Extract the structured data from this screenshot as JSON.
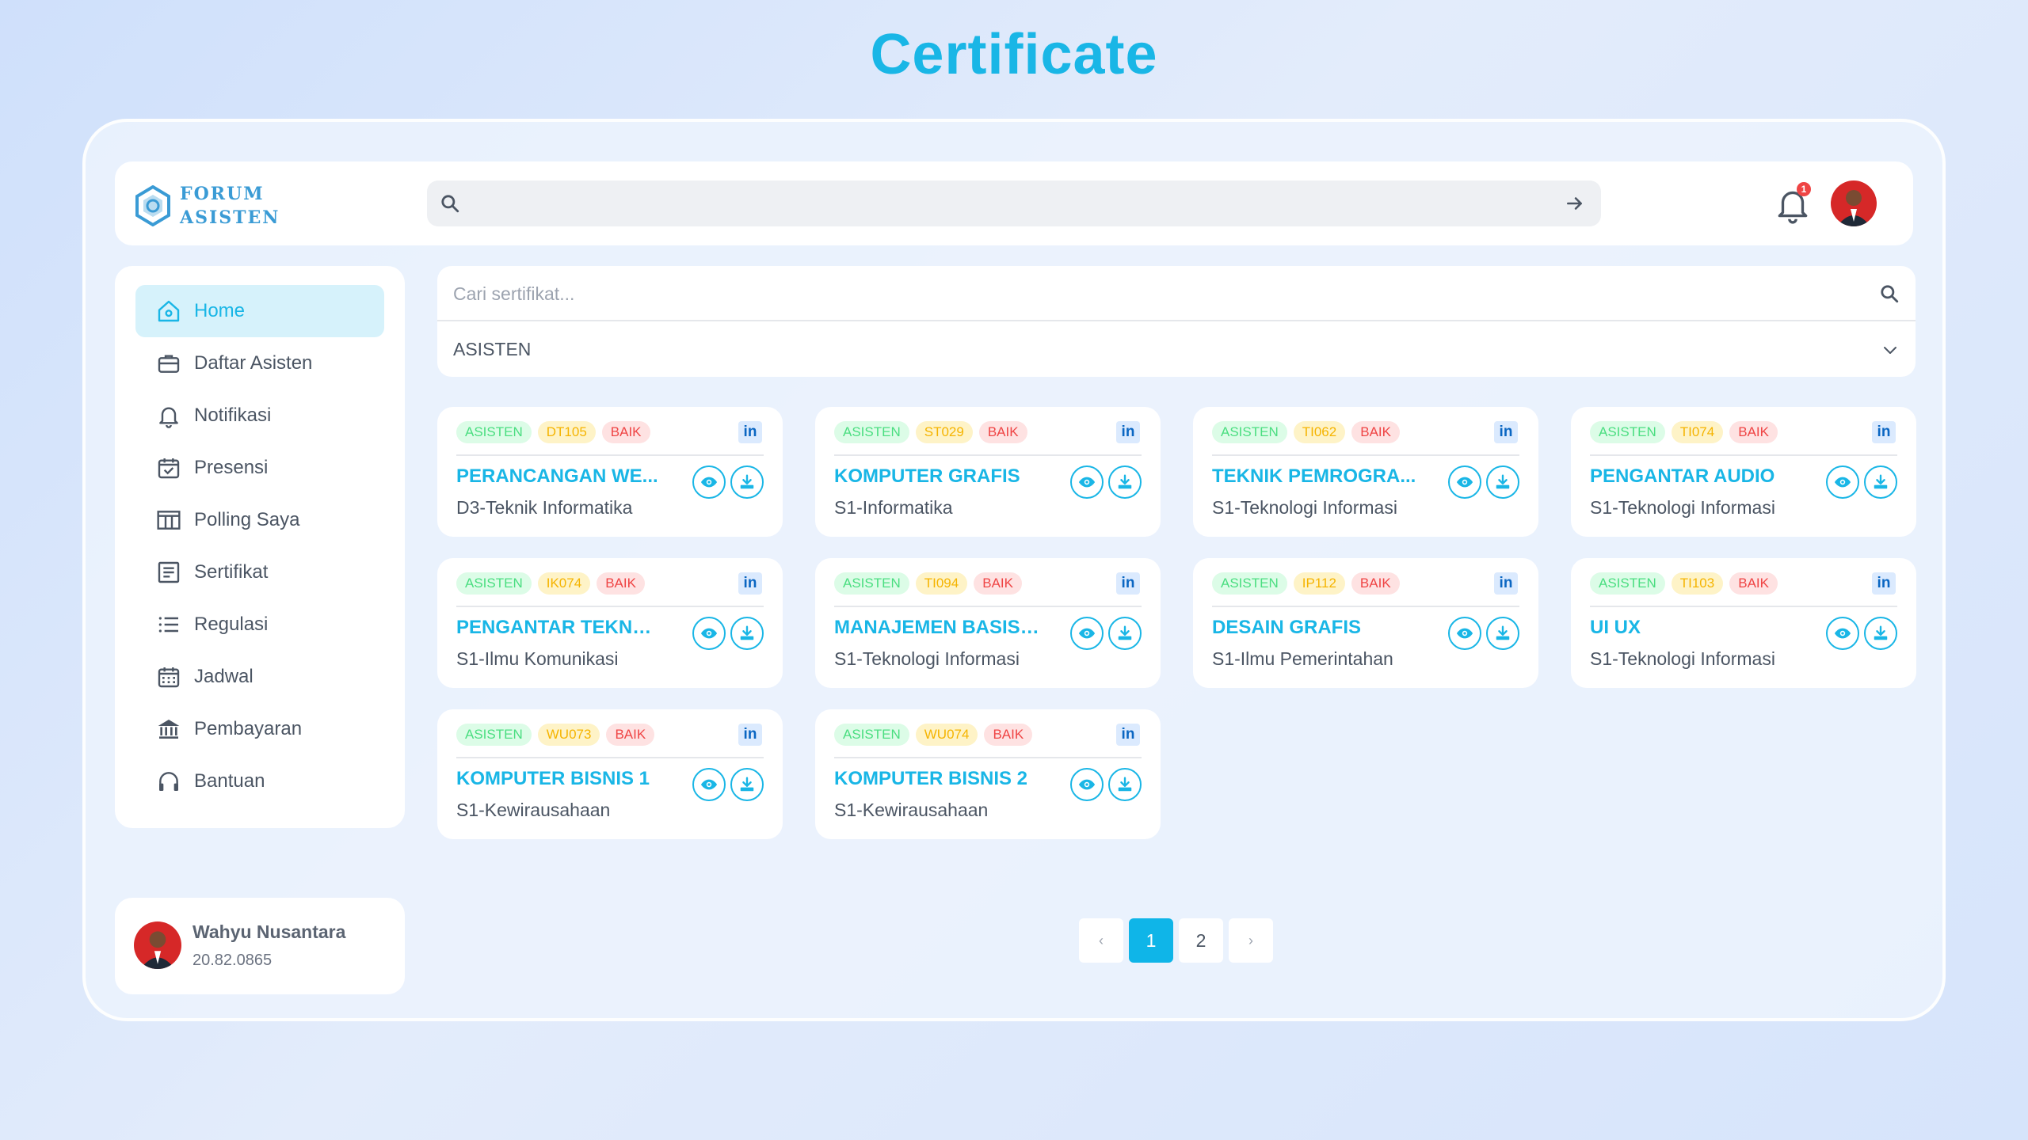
{
  "page": {
    "title": "Certificate"
  },
  "header": {
    "logo_line1": "FORUM",
    "logo_line2": "ASISTEN",
    "search_placeholder": "",
    "notification_count": "1"
  },
  "sidebar": {
    "items": [
      {
        "label": "Home",
        "icon": "home-icon",
        "active": true
      },
      {
        "label": "Daftar Asisten",
        "icon": "briefcase-icon"
      },
      {
        "label": "Notifikasi",
        "icon": "bell-icon"
      },
      {
        "label": "Presensi",
        "icon": "calendar-check-icon"
      },
      {
        "label": "Polling Saya",
        "icon": "table-icon"
      },
      {
        "label": "Sertifikat",
        "icon": "document-icon"
      },
      {
        "label": "Regulasi",
        "icon": "list-icon"
      },
      {
        "label": "Jadwal",
        "icon": "calendar-icon"
      },
      {
        "label": "Pembayaran",
        "icon": "bank-icon"
      },
      {
        "label": "Bantuan",
        "icon": "headphones-icon"
      }
    ]
  },
  "user": {
    "name": "Wahyu Nusantara",
    "id": "20.82.0865"
  },
  "filter": {
    "search_placeholder": "Cari sertifikat...",
    "selected": "ASISTEN"
  },
  "certificates": [
    {
      "role": "ASISTEN",
      "code": "DT105",
      "grade": "BAIK",
      "title": "PERANCANGAN WE...",
      "program": "D3-Teknik Informatika"
    },
    {
      "role": "ASISTEN",
      "code": "ST029",
      "grade": "BAIK",
      "title": "KOMPUTER GRAFIS",
      "program": "S1-Informatika"
    },
    {
      "role": "ASISTEN",
      "code": "TI062",
      "grade": "BAIK",
      "title": "TEKNIK PEMROGRA...",
      "program": "S1-Teknologi Informasi"
    },
    {
      "role": "ASISTEN",
      "code": "TI074",
      "grade": "BAIK",
      "title": "PENGANTAR AUDIO",
      "program": "S1-Teknologi Informasi"
    },
    {
      "role": "ASISTEN",
      "code": "IK074",
      "grade": "BAIK",
      "title": "PENGANTAR TEKNO...",
      "program": "S1-Ilmu Komunikasi"
    },
    {
      "role": "ASISTEN",
      "code": "TI094",
      "grade": "BAIK",
      "title": "MANAJEMEN BASIS ...",
      "program": "S1-Teknologi Informasi"
    },
    {
      "role": "ASISTEN",
      "code": "IP112",
      "grade": "BAIK",
      "title": "DESAIN GRAFIS",
      "program": "S1-Ilmu Pemerintahan"
    },
    {
      "role": "ASISTEN",
      "code": "TI103",
      "grade": "BAIK",
      "title": "UI UX",
      "program": "S1-Teknologi Informasi"
    },
    {
      "role": "ASISTEN",
      "code": "WU073",
      "grade": "BAIK",
      "title": "KOMPUTER BISNIS 1",
      "program": "S1-Kewirausahaan"
    },
    {
      "role": "ASISTEN",
      "code": "WU074",
      "grade": "BAIK",
      "title": "KOMPUTER BISNIS 2",
      "program": "S1-Kewirausahaan"
    }
  ],
  "linkedin_label": "in",
  "pagination": {
    "prev": "‹",
    "pages": [
      "1",
      "2"
    ],
    "current": "1",
    "next": "›"
  },
  "colors": {
    "accent": "#19b6e6",
    "role_tag": "#4ade80",
    "code_tag": "#f5b400",
    "grade_tag": "#ef4444"
  }
}
